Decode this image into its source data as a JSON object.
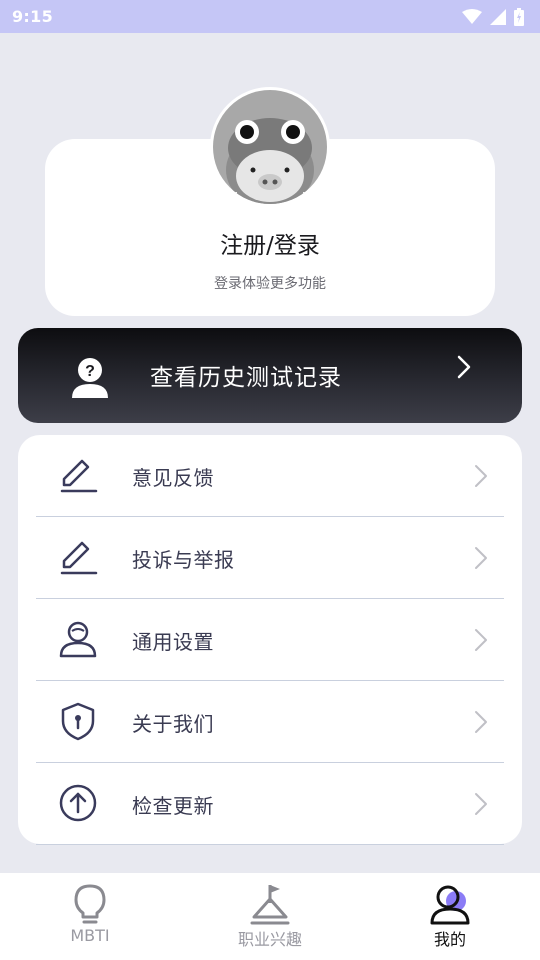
{
  "status_bar": {
    "time": "9:15"
  },
  "profile": {
    "title": "注册/登录",
    "subtitle": "登录体验更多功能"
  },
  "history": {
    "label": "查看历史测试记录"
  },
  "menu": {
    "items": [
      {
        "label": "意见反馈",
        "icon": "edit-icon"
      },
      {
        "label": "投诉与举报",
        "icon": "edit-icon"
      },
      {
        "label": "通用设置",
        "icon": "user-settings-icon"
      },
      {
        "label": "关于我们",
        "icon": "shield-icon"
      },
      {
        "label": "检查更新",
        "icon": "arrow-up-circle-icon"
      }
    ]
  },
  "bottom_nav": {
    "items": [
      {
        "label": "MBTI",
        "icon": "lightbulb-icon"
      },
      {
        "label": "职业兴趣",
        "icon": "flag-icon"
      },
      {
        "label": "我的",
        "icon": "profile-icon",
        "active": true
      }
    ]
  },
  "colors": {
    "background": "#e8e9f0",
    "status_bar": "#c5c6f6",
    "accent": "#8b7cf6",
    "icon_navy": "#3a3b5c"
  }
}
